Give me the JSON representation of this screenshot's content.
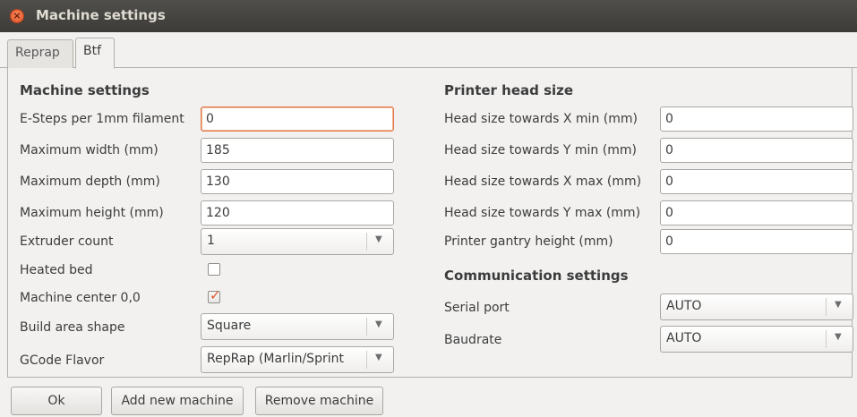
{
  "window": {
    "title": "Machine settings"
  },
  "tabs": [
    {
      "label": "Reprap",
      "active": false
    },
    {
      "label": "Btf",
      "active": true
    }
  ],
  "machine_settings": {
    "title": "Machine settings",
    "esteps": {
      "label": "E-Steps per 1mm filament",
      "value": "0"
    },
    "max_width": {
      "label": "Maximum width (mm)",
      "value": "185"
    },
    "max_depth": {
      "label": "Maximum depth (mm)",
      "value": "130"
    },
    "max_height": {
      "label": "Maximum height (mm)",
      "value": "120"
    },
    "extruder_count": {
      "label": "Extruder count",
      "value": "1"
    },
    "heated_bed": {
      "label": "Heated bed",
      "checked": false
    },
    "machine_center": {
      "label": "Machine center 0,0",
      "checked": true
    },
    "build_area_shape": {
      "label": "Build area shape",
      "value": "Square"
    },
    "gcode_flavor": {
      "label": "GCode Flavor",
      "value": "RepRap (Marlin/Sprint"
    }
  },
  "printer_head": {
    "title": "Printer head size",
    "x_min": {
      "label": "Head size towards X min (mm)",
      "value": "0"
    },
    "y_min": {
      "label": "Head size towards Y min (mm)",
      "value": "0"
    },
    "x_max": {
      "label": "Head size towards X max (mm)",
      "value": "0"
    },
    "y_max": {
      "label": "Head size towards Y max (mm)",
      "value": "0"
    },
    "gantry_height": {
      "label": "Printer gantry height (mm)",
      "value": "0"
    }
  },
  "communication": {
    "title": "Communication settings",
    "serial_port": {
      "label": "Serial port",
      "value": "AUTO"
    },
    "baudrate": {
      "label": "Baudrate",
      "value": "AUTO"
    }
  },
  "buttons": {
    "ok": "Ok",
    "add_machine": "Add new machine",
    "remove_machine": "Remove machine"
  },
  "icons": {
    "close": "close-icon",
    "dropdown": "chevron-down-icon",
    "check": "checkmark-icon"
  },
  "colors": {
    "titlebar": "#3c3b37",
    "accent": "#e2552c",
    "background": "#f2f1f0"
  }
}
